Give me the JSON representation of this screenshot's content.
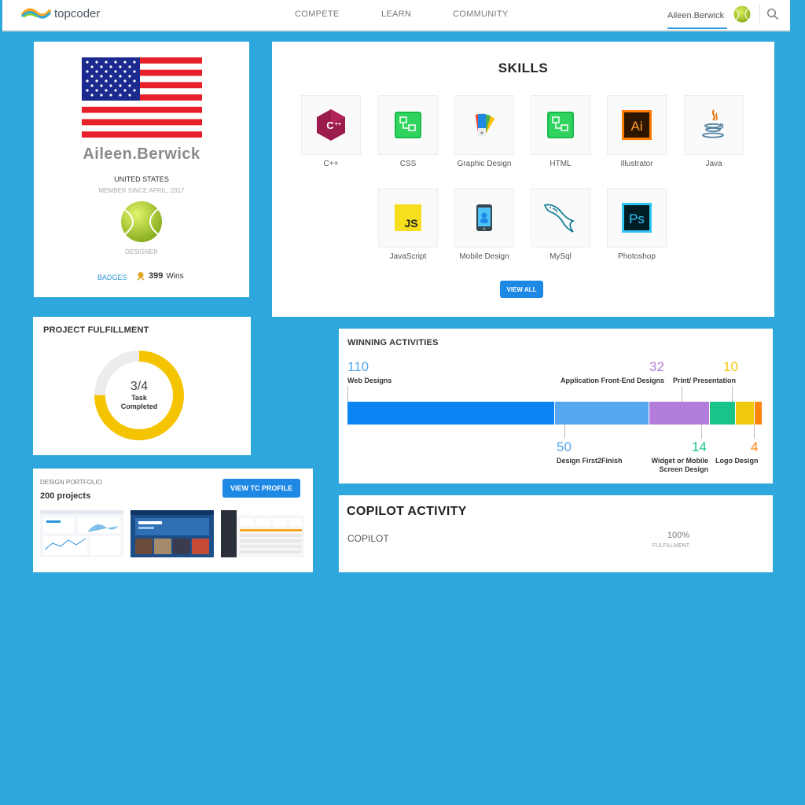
{
  "header": {
    "logo_text": "topcoder",
    "nav": [
      "COMPETE",
      "LEARN",
      "COMMUNITY"
    ],
    "user_name": "Aileen.Berwick"
  },
  "profile": {
    "handle": "Aileen.Berwick",
    "country": "UNITED STATES",
    "member_since": "MEMBER SINCE APRIL, 2017",
    "role": "DESIGNER",
    "badges_label": "BADGES",
    "wins_count": "399",
    "wins_label": "Wins"
  },
  "skills": {
    "title": "SKILLS",
    "items": [
      {
        "label": "C++",
        "icon": "cpp-icon"
      },
      {
        "label": "CSS",
        "icon": "css-icon"
      },
      {
        "label": "Graphic Design",
        "icon": "graphic-design-icon"
      },
      {
        "label": "HTML",
        "icon": "html-icon"
      },
      {
        "label": "Illustrator",
        "icon": "illustrator-icon"
      },
      {
        "label": "Java",
        "icon": "java-icon"
      },
      {
        "label": "JavaScript",
        "icon": "javascript-icon"
      },
      {
        "label": "Mobile Design",
        "icon": "mobile-design-icon"
      },
      {
        "label": "MySql",
        "icon": "mysql-icon"
      },
      {
        "label": "Photoshop",
        "icon": "photoshop-icon"
      }
    ],
    "view_all_label": "VIEW ALL"
  },
  "fulfillment": {
    "title": "PROJECT FULFILLMENT",
    "value": "3/4",
    "line1": "Task",
    "line2": "Completed",
    "fraction": 0.75
  },
  "portfolio": {
    "label": "DESIGN PORTFOLIO",
    "count": "200 projects",
    "button_label": "VIEW TC PROFILE"
  },
  "winning": {
    "title": "WINNING ACTIVITIES",
    "segments": [
      {
        "value": "110",
        "label": "Web Designs",
        "color": "#0b84f3"
      },
      {
        "value": "50",
        "label": "Design First2Finish",
        "color": "#55a7ef"
      },
      {
        "value": "32",
        "label": "Application Front-End Designs",
        "color": "#b37ddb"
      },
      {
        "value": "14",
        "label_line1": "Widget or Mobile",
        "label_line2": "Screen Design",
        "color": "#19c48a"
      },
      {
        "value": "10",
        "label": "Print/ Presentation",
        "color": "#f2c80f"
      },
      {
        "value": "4",
        "label": "Logo Design",
        "color": "#fd850d"
      }
    ]
  },
  "copilot": {
    "title": "COPILOT ACTIVITY",
    "label": "COPILOT",
    "percent": "100%",
    "sub": "FULFILLMENT"
  }
}
